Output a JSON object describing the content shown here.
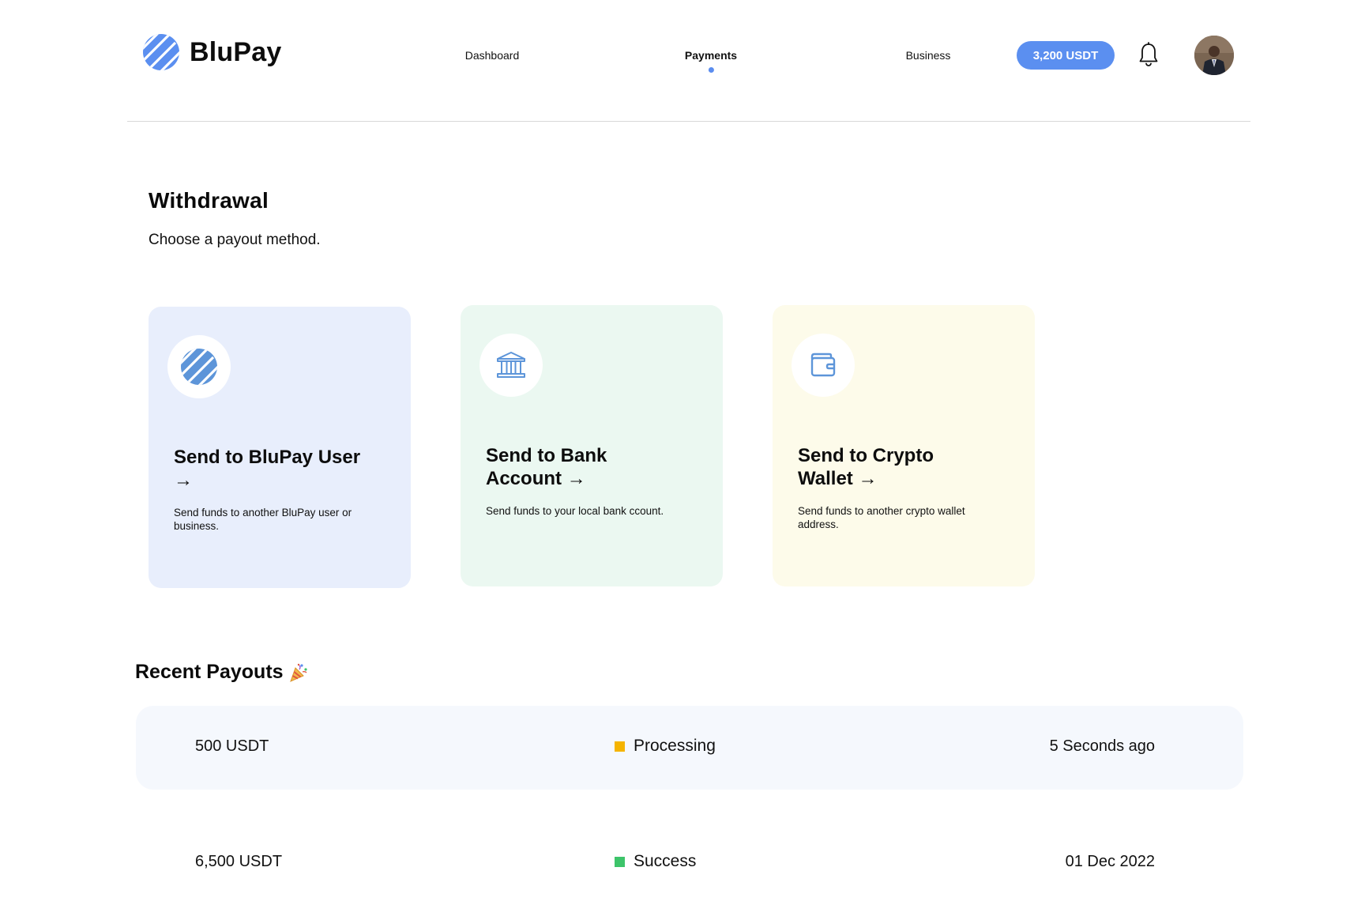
{
  "brand": {
    "name": "BluPay",
    "accent": "#5B8FF0",
    "icon": "blupay-logo-icon"
  },
  "nav": {
    "items": [
      {
        "label": "Dashboard",
        "active": false
      },
      {
        "label": "Payments",
        "active": true
      },
      {
        "label": "Business",
        "active": false
      }
    ]
  },
  "header": {
    "balance": "3,200 USDT",
    "bell_icon": "bell-icon",
    "avatar_icon": "user-avatar"
  },
  "withdrawal": {
    "title": "Withdrawal",
    "subtitle": "Choose a payout method."
  },
  "methods": [
    {
      "title": "Send to BluPay User →",
      "description": "Send funds to another BluPay user or business.",
      "icon": "blupay-logo-icon",
      "background": "#E8EEFC"
    },
    {
      "title": "Send to Bank Account →",
      "description": "Send funds to your local bank ccount.",
      "icon": "bank-icon",
      "background": "#EBF8F1"
    },
    {
      "title": "Send to Crypto Wallet →",
      "description": "Send funds to another crypto wallet address.",
      "icon": "wallet-icon",
      "background": "#FDFBEA"
    }
  ],
  "recent_payouts": {
    "title": "Recent Payouts",
    "title_icon": "party-popper-icon",
    "rows": [
      {
        "amount": "500 USDT",
        "status": "Processing",
        "status_color": "#F5B400",
        "time": "5 Seconds ago"
      },
      {
        "amount": "6,500 USDT",
        "status": "Success",
        "status_color": "#3DC46A",
        "time": "01 Dec 2022"
      }
    ]
  }
}
